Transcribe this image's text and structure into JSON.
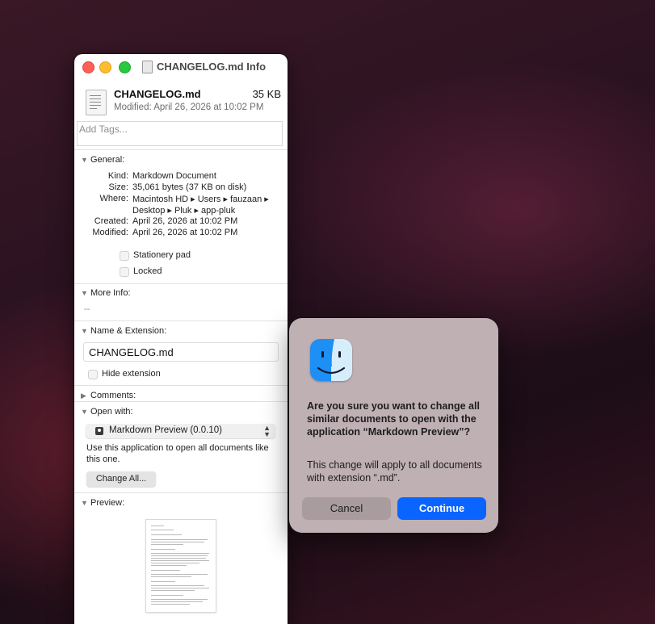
{
  "window": {
    "title": "CHANGELOG.md Info"
  },
  "file": {
    "name": "CHANGELOG.md",
    "size": "35 KB",
    "modified_summary": "Modified: April 26, 2026 at 10:02 PM",
    "tags_placeholder": "Add Tags..."
  },
  "general": {
    "heading": "General:",
    "rows": [
      {
        "key": "Kind:",
        "value": "Markdown Document"
      },
      {
        "key": "Size:",
        "value": "35,061 bytes (37 KB on disk)"
      },
      {
        "key": "Where:",
        "value": "Macintosh HD ▸ Users ▸ fauzaan ▸"
      },
      {
        "key": "",
        "value": "Desktop ▸ Pluk ▸ app-pluk"
      },
      {
        "key": "Created:",
        "value": "April 26, 2026 at 10:02 PM"
      },
      {
        "key": "Modified:",
        "value": "April 26, 2026 at 10:02 PM"
      }
    ],
    "stationery_label": "Stationery pad",
    "locked_label": "Locked"
  },
  "more_info": {
    "heading": "More Info:",
    "value": "--"
  },
  "name_ext": {
    "heading": "Name & Extension:",
    "value": "CHANGELOG.md",
    "hide_label": "Hide extension"
  },
  "comments": {
    "heading": "Comments:"
  },
  "open_with": {
    "heading": "Open with:",
    "app": "Markdown Preview (0.0.10)",
    "description": "Use this application to open all documents like this one.",
    "change_all": "Change All..."
  },
  "preview": {
    "heading": "Preview:"
  },
  "dialog": {
    "title": "Are you sure you want to change all similar documents to open with the application “Markdown Preview”?",
    "message": "This change will apply to all documents with extension “.md”.",
    "cancel": "Cancel",
    "continue": "Continue"
  },
  "colors": {
    "accent": "#0a64ff",
    "close": "#fe5f57",
    "minimize": "#febc2e",
    "zoom": "#28c840"
  }
}
